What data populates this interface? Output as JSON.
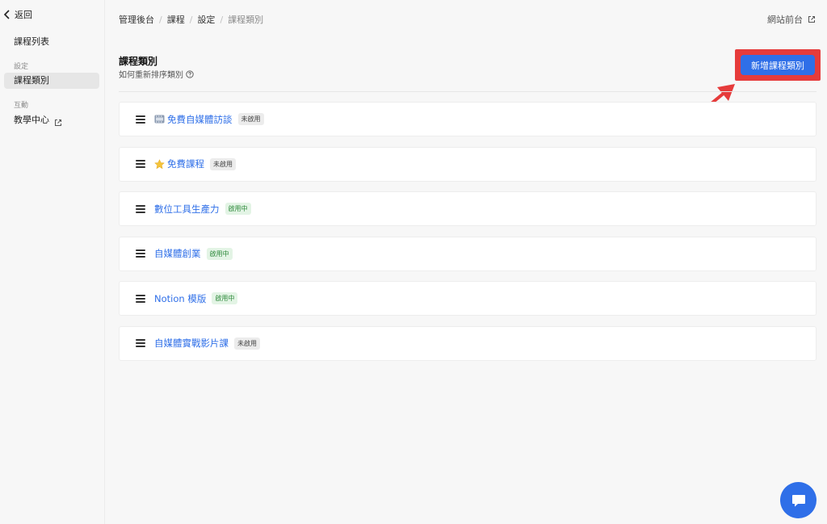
{
  "sidebar": {
    "back_label": "返回",
    "items": [
      {
        "label": "課程列表"
      },
      {
        "section": "設定"
      },
      {
        "label": "課程類別"
      },
      {
        "section": "互動"
      },
      {
        "label": "教學中心"
      }
    ]
  },
  "breadcrumb": [
    "管理後台",
    "課程",
    "設定",
    "課程類別"
  ],
  "front_link": "網站前台",
  "page": {
    "title": "課程類別",
    "subtitle": "如何重新排序類別"
  },
  "add_button": "新增課程類別",
  "categories": [
    {
      "name": "免費自媒體訪談",
      "status": "未啟用",
      "emoji": "film-frames-icon"
    },
    {
      "name": "免費課程",
      "status": "未啟用",
      "emoji": "star-icon"
    },
    {
      "name": "數位工具生產力",
      "status": "啟用中"
    },
    {
      "name": "自媒體創業",
      "status": "啟用中"
    },
    {
      "name": "Notion 模版",
      "status": "啟用中"
    },
    {
      "name": "自媒體實戰影片課",
      "status": "未啟用"
    }
  ],
  "colors": {
    "primary": "#2f6fe8",
    "highlight": "#e63b3b",
    "active_badge_bg": "#e3f4e5",
    "inactive_badge_bg": "#ececec"
  }
}
